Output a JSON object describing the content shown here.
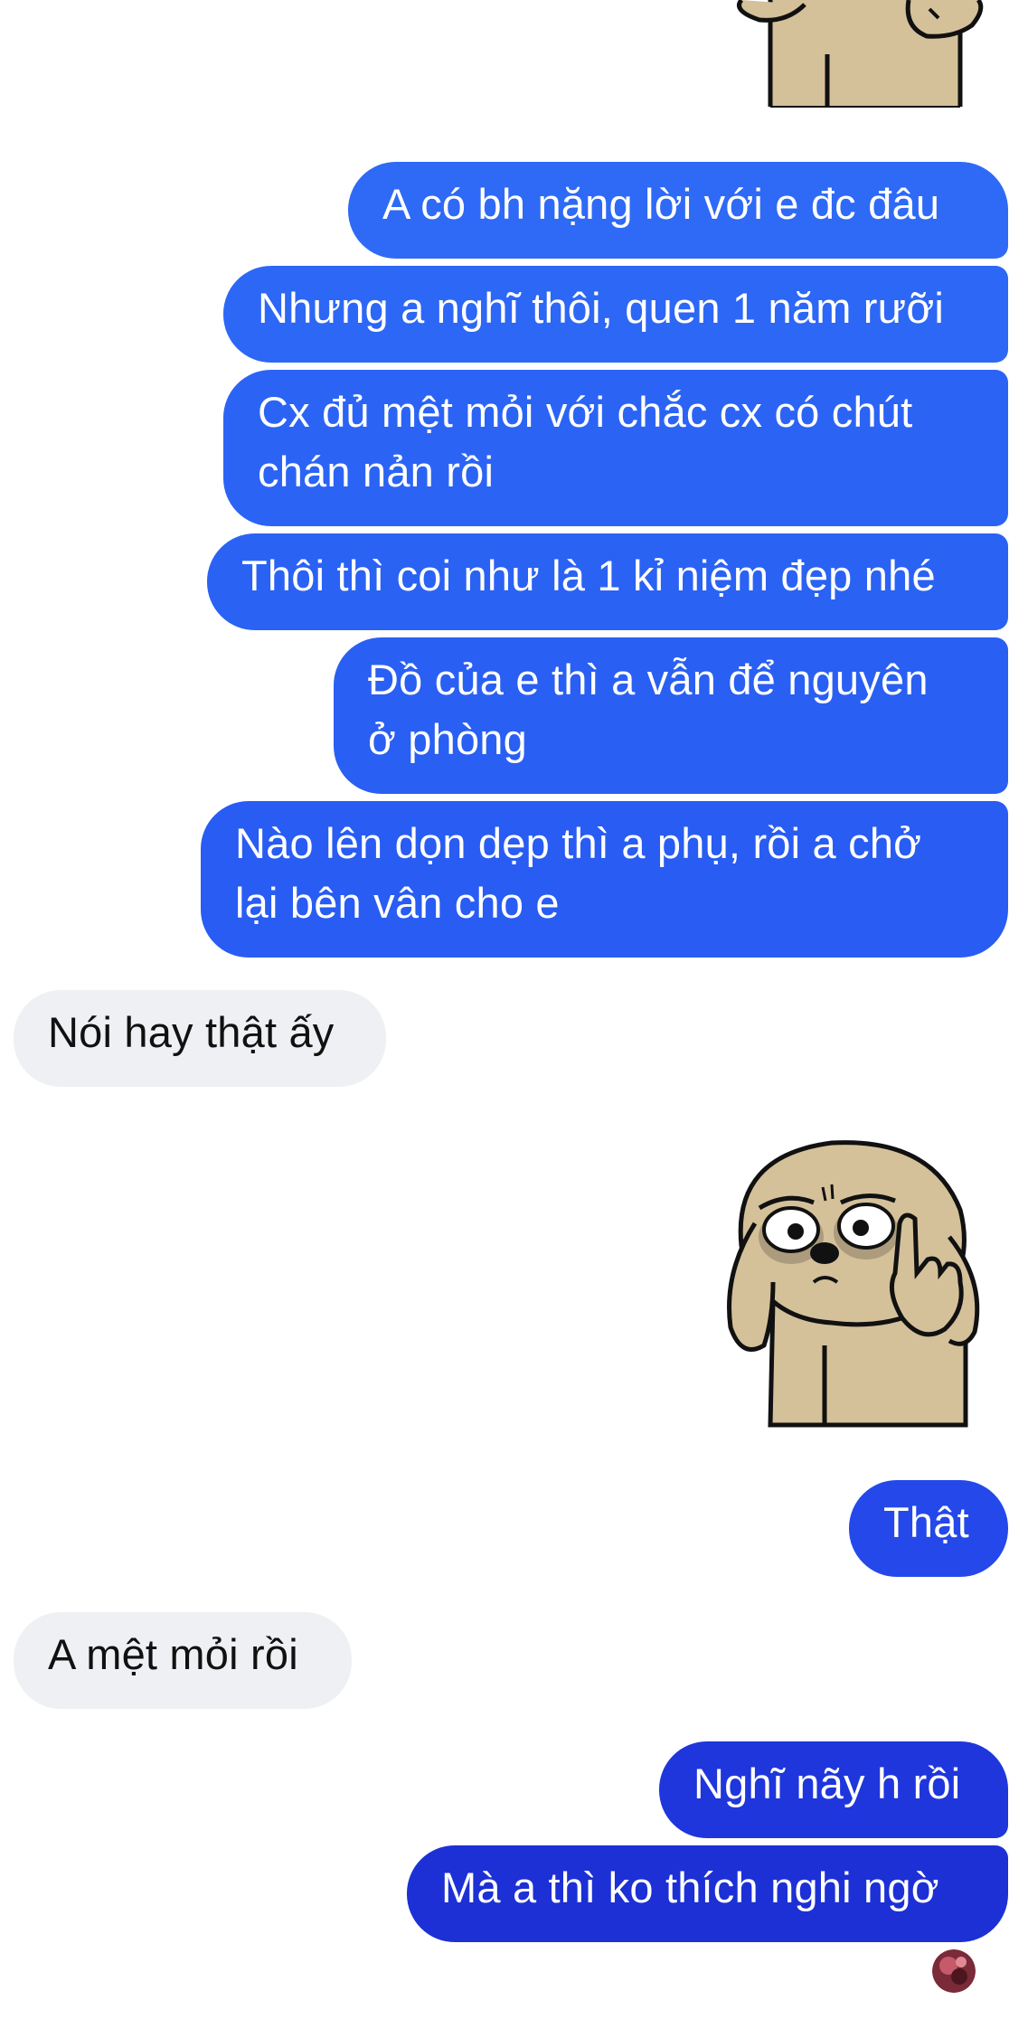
{
  "colors": {
    "outgoing_top": "#2d66f5",
    "outgoing_bottom": "#1c33d7",
    "incoming_bg": "#eff0f3",
    "incoming_text": "#111111",
    "sticker_fur": "#d4c19a"
  },
  "messages": [
    {
      "id": "m1",
      "direction": "outgoing",
      "text": "A có bh nặng lời với e đc đâu"
    },
    {
      "id": "m2",
      "direction": "outgoing",
      "text": "Nhưng a nghĩ thôi, quen 1 năm rưỡi"
    },
    {
      "id": "m3",
      "direction": "outgoing",
      "text": "Cx đủ mệt mỏi với chắc cx có chút\nchán nản rồi"
    },
    {
      "id": "m4",
      "direction": "outgoing",
      "text": "Thôi thì coi như là 1 kỉ niệm đẹp nhé"
    },
    {
      "id": "m5",
      "direction": "outgoing",
      "text": "Đồ của e thì a vẫn để nguyên\nở phòng"
    },
    {
      "id": "m6",
      "direction": "outgoing",
      "text": "Nào lên dọn dẹp thì a phụ, rồi a chở\nlại bên vân cho e"
    },
    {
      "id": "m7",
      "direction": "incoming",
      "text": "Nói hay thật ấy"
    },
    {
      "id": "s2",
      "direction": "outgoing",
      "type": "sticker",
      "icon": "puppy-pointing-sticker"
    },
    {
      "id": "m8",
      "direction": "outgoing",
      "text": "Thật"
    },
    {
      "id": "m9",
      "direction": "incoming",
      "text": "A mệt mỏi rồi"
    },
    {
      "id": "m10",
      "direction": "outgoing",
      "text": "Nghĩ nãy h rồi"
    },
    {
      "id": "m11",
      "direction": "outgoing",
      "text": "Mà a thì ko thích nghi ngờ"
    }
  ],
  "top_sticker": {
    "icon": "puppy-sticker-partial"
  },
  "read_receipt": {
    "icon": "avatar-read-receipt"
  }
}
